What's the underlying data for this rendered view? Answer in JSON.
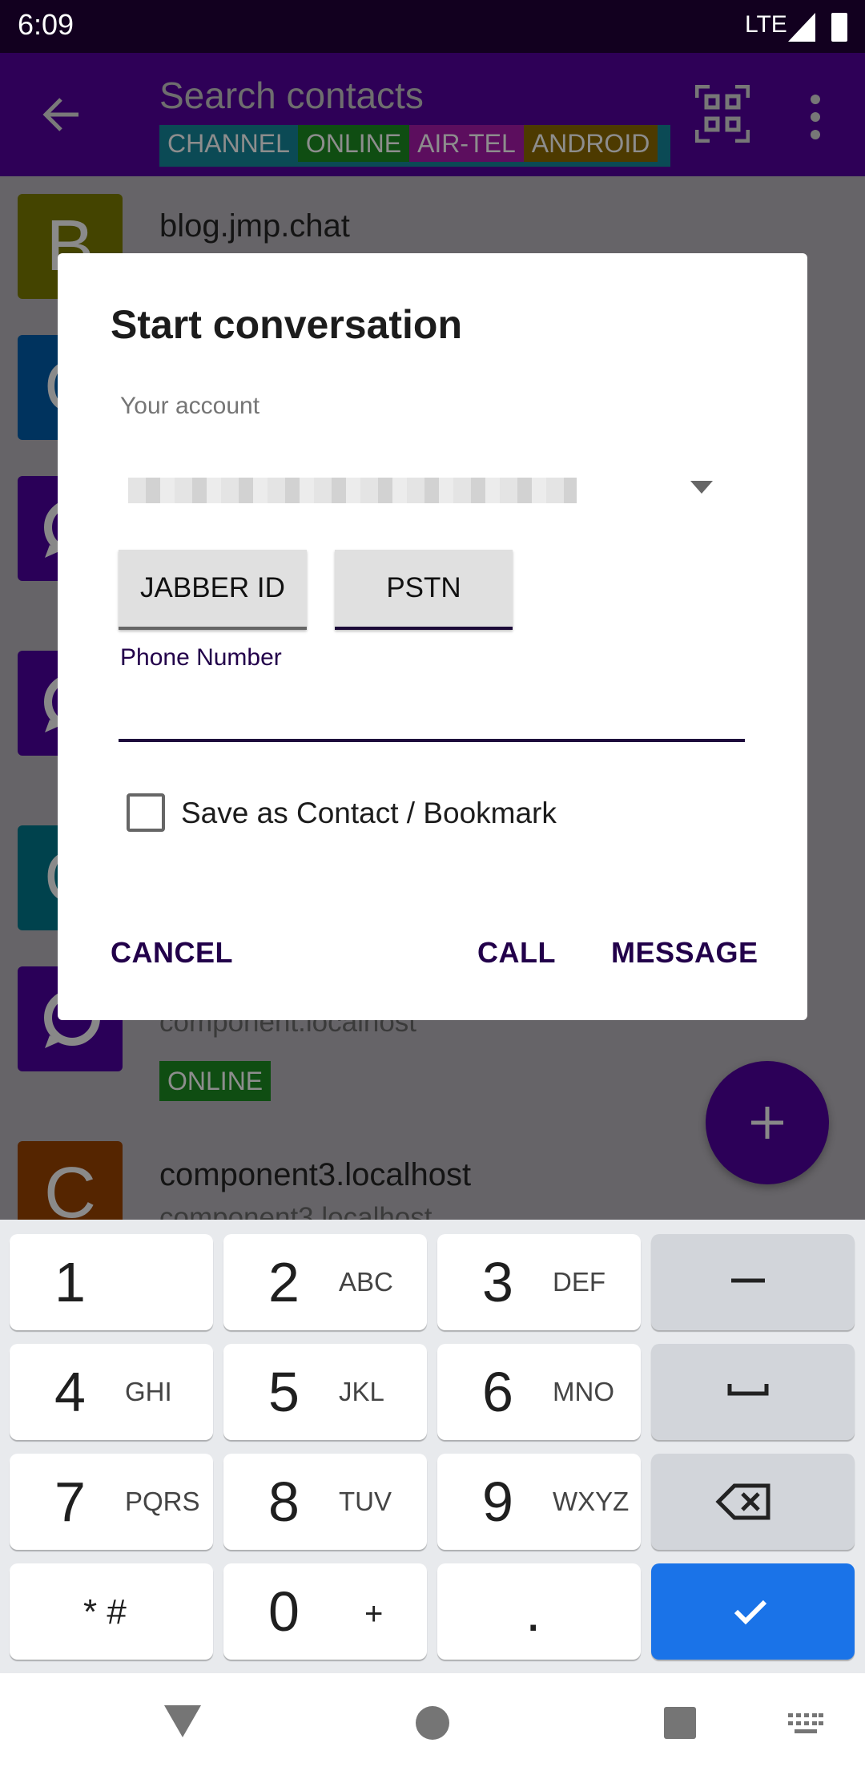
{
  "status_bar": {
    "time": "6:09",
    "network": "LTE"
  },
  "app_bar": {
    "search_placeholder": "Search contacts",
    "tags": [
      {
        "label": "CHANNEL",
        "color": "#0b4a55"
      },
      {
        "label": "ONLINE",
        "color": "#0f4d12"
      },
      {
        "label": "AIR-TEL",
        "color": "#5c0e5e"
      },
      {
        "label": "ANDROID",
        "color": "#4d3a00"
      }
    ],
    "icons": [
      "back-arrow-icon",
      "qr-code-icon",
      "more-vert-icon"
    ]
  },
  "contacts": [
    {
      "initial": "B",
      "name": "blog.jmp.chat",
      "color": "#444400"
    },
    {
      "initial": "C",
      "color": "#00335e"
    },
    {
      "initial": "",
      "color": "#2a0058"
    },
    {
      "initial": "",
      "color": "#2a0058"
    },
    {
      "initial": "C",
      "color": "#00424d"
    },
    {
      "initial": "",
      "sub": "component.localhost",
      "tag": "ONLINE",
      "color": "#2a0058"
    },
    {
      "initial": "C",
      "name": "component3.localhost",
      "sub": "component3.localhost",
      "color": "#552500"
    }
  ],
  "fab": {
    "icon": "plus-icon"
  },
  "dialog": {
    "title": "Start conversation",
    "account_label": "Your account",
    "toggle_jabber": "JABBER ID",
    "toggle_pstn": "PSTN",
    "input_label": "Phone Number",
    "input_value": "",
    "checkbox_label": "Save as Contact / Bookmark",
    "checkbox_checked": false,
    "cancel": "CANCEL",
    "call": "CALL",
    "message": "MESSAGE"
  },
  "keyboard": {
    "keys": [
      {
        "n": "1",
        "l": ""
      },
      {
        "n": "2",
        "l": "ABC"
      },
      {
        "n": "3",
        "l": "DEF"
      },
      {
        "n": "−",
        "l": ""
      },
      {
        "n": "4",
        "l": "GHI"
      },
      {
        "n": "5",
        "l": "JKL"
      },
      {
        "n": "6",
        "l": "MNO"
      },
      {
        "n": "␣",
        "l": ""
      },
      {
        "n": "7",
        "l": "PQRS"
      },
      {
        "n": "8",
        "l": "TUV"
      },
      {
        "n": "9",
        "l": "WXYZ"
      },
      {
        "n": "⌫",
        "l": ""
      },
      {
        "n": "* #",
        "l": ""
      },
      {
        "n": "0",
        "l": "+"
      },
      {
        "n": ".",
        "l": ""
      },
      {
        "n": "✓",
        "l": ""
      }
    ]
  }
}
